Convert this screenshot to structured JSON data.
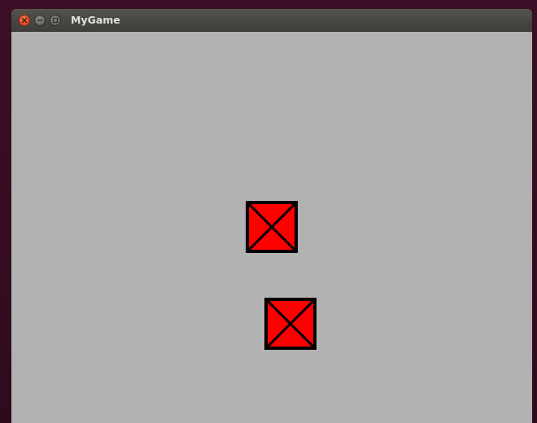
{
  "window": {
    "title": "MyGame",
    "controls": {
      "close_icon": "close-icon",
      "minimize_icon": "minimize-icon",
      "maximize_icon": "maximize-icon"
    }
  },
  "game": {
    "background_color": "#b2b2b2",
    "sprite_fill": "#ff0000",
    "sprite_outline": "#000000",
    "sprites": [
      {
        "name": "crate-1"
      },
      {
        "name": "crate-2"
      }
    ]
  }
}
